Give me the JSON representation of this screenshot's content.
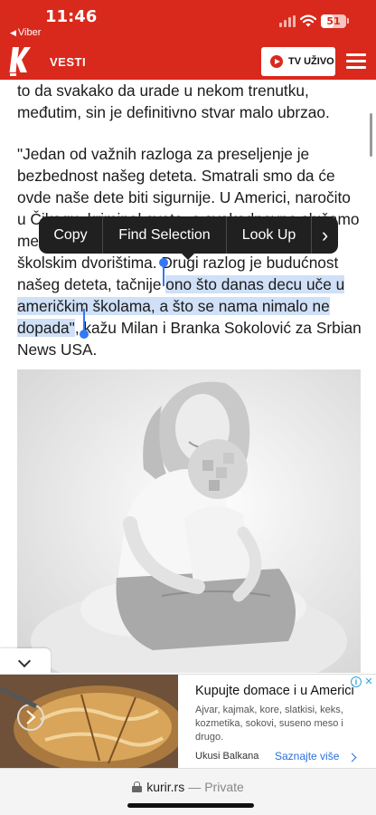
{
  "status_bar": {
    "time": "11:46",
    "back_app": "Viber",
    "battery_level": "51",
    "battery_fraction": 0.51
  },
  "header": {
    "logo_letter": "K",
    "section": "VESTI",
    "tv_button": "TV UŽIVO",
    "colors": {
      "brand_red": "#d9291c"
    }
  },
  "article": {
    "p1_line1": "to da svakako da urade u nekom trenutku,",
    "p1_line2": "međutim, sin je definitivno stvar malo ubrzao.",
    "p2_lines": [
      "\"Jedan od važnih razloga za preseljenje je",
      "bezbednost našeg deteta. Smatrali smo da će",
      "ovde naše dete biti sigurnije. U Americi, naročito",
      "u Čikagu, kriminal cveta, a svakodnevno slušamo",
      "me",
      "školskim dvorištima. Drugi razlog je budućnost"
    ],
    "p2_line7_before": "našeg deteta, tačnije ",
    "selection_line1": "ono što danas decu uče u",
    "selection_line2": "američkim školama, a što se nama nimalo ne",
    "selection_line3": "dopada\"",
    "p2_after_selection": ", kažu Milan i Branka Sokolović za Srbian",
    "p2_last_line": "News USA."
  },
  "context_menu": {
    "items": [
      "Copy",
      "Find Selection",
      "Look Up"
    ],
    "more": "›"
  },
  "ad": {
    "title": "Kupujte domace i u Americi",
    "description": "Ajvar, kajmak, kore, slatkisi, keks, kozmetika, sokovi, suseno meso i drugo.",
    "source": "Ukusi Balkana",
    "cta": "Saznajte više"
  },
  "url_bar": {
    "domain": "kurir.rs",
    "separator": "—",
    "mode": "Private"
  },
  "icons": [
    "signal-icon",
    "wifi-icon",
    "battery-icon",
    "play-icon",
    "hamburger-icon",
    "chevron-down-icon",
    "info-icon",
    "close-icon",
    "lock-icon"
  ]
}
